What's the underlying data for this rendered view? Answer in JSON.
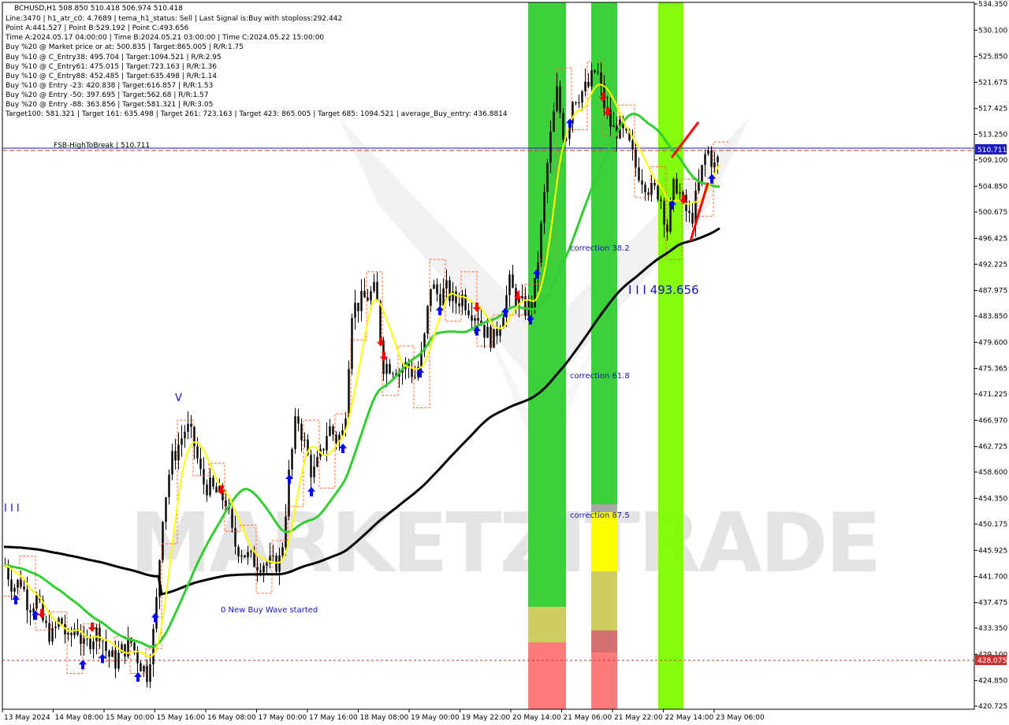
{
  "symbol_line": "BCHUSD,H1  508.850 510.418 506.974 510.418",
  "info_lines": [
    "Line:3470  |  h1_atr_c0: 4.7689  |  tema_h1_status: Sell  |  Last Signal is:Buy with stoploss:292.442",
    "Point A:441.527  |  Point B:529.192  |  Point C:493.656",
    "Time A:2024.05.17 04:00:00  |  Time B:2024.05.21 03:00:00  |  Time C:2024.05.22 15:00:00",
    "Buy %20 @ Market price or at: 500.835  |  Target:865.005  |  R/R:1.75",
    "Buy %10 @ C_Entry38: 495.704  |  Target:1094.521  |  R/R:2.95",
    "Buy %10 @ C_Entry61: 475.015  |  Target:723.163  |  R/R:1.36",
    "Buy %10 @ C_Entry88: 452.485  |  Target:635.498  |  R/R:1.14",
    "Buy %10 @ Entry -23: 420.838  |  Target:616.857  |  R/R:1.53",
    "Buy %20 @ Entry -50: 397.695  |  Target:562.68  |  R/R:1.57",
    "Buy %20 @ Entry -88: 363.856  |  Target:581.321  |  R/R:3.05",
    "Target100: 581.321  |  Target 161: 635.498  |  Target 261: 723.163  |  Target 423: 865.005  |  Target 685: 1094.521  |  average_Buy_entry: 436.8814"
  ],
  "annotations": {
    "fsb": "FSB-HighToBreak  |  510.711",
    "correction_38": "correction 38.2",
    "correction_61": "correction 61.8",
    "correction_87": "correction 87.5",
    "point_c": "I I I  493.656",
    "wave_start": "0 New Buy Wave started",
    "left_marker": "I I I",
    "v_marker": "V"
  },
  "price_axis": {
    "ticks": [
      "534.350",
      "530.100",
      "525.850",
      "521.675",
      "517.425",
      "513.250",
      "509.100",
      "504.850",
      "500.675",
      "496.425",
      "492.225",
      "487.975",
      "483.850",
      "479.600",
      "475.365",
      "471.225",
      "466.970",
      "462.725",
      "458.600",
      "454.350",
      "450.175",
      "445.925",
      "441.700",
      "437.475",
      "433.350",
      "429.100",
      "424.850",
      "420.725"
    ],
    "current_price": "510.711",
    "line_428": "428.075",
    "current_color": "#1e1ebe",
    "line_428_color": "#c83232"
  },
  "time_axis": {
    "labels": [
      "13 May 2024",
      "14 May 08:00",
      "15 May 00:00",
      "15 May 16:00",
      "16 May 08:00",
      "17 May 00:00",
      "17 May 16:00",
      "18 May 08:00",
      "19 May 00:00",
      "19 May 22:00",
      "20 May 14:00",
      "21 May 06:00",
      "21 May 22:00",
      "22 May 14:00",
      "23 May 06:00"
    ]
  },
  "watermark": "MARKETZITRADE",
  "colors": {
    "bull_band": "#32cd32",
    "bear_zone": "#ff6464",
    "yellow_zone": "#ffff00",
    "tema_fast": "#ffff00",
    "ma_mid": "#32cd32",
    "ma_slow": "#000000",
    "buy_arrow": "#0000ff",
    "sell_arrow": "#ff0000",
    "stop_line": "#ff6432"
  },
  "chart_data": {
    "type": "candlestick",
    "symbol": "BCHUSD",
    "timeframe": "H1",
    "ylim": [
      420.725,
      534.35
    ],
    "x_range": [
      "2024-05-13",
      "2024-05-23 09:00"
    ],
    "ohlc_last": {
      "open": 508.85,
      "high": 510.418,
      "low": 506.974,
      "close": 510.418
    },
    "key_levels": {
      "point_a": 441.527,
      "point_b": 529.192,
      "point_c": 493.656,
      "fsb_high_to_break": 510.711,
      "stop_line": 428.075
    },
    "price_path": [
      [
        0,
        443.5
      ],
      [
        10,
        440
      ],
      [
        20,
        441
      ],
      [
        30,
        437
      ],
      [
        40,
        438
      ],
      [
        50,
        433.5
      ],
      [
        60,
        432
      ],
      [
        70,
        435
      ],
      [
        80,
        431
      ],
      [
        90,
        434
      ],
      [
        100,
        430
      ],
      [
        110,
        432
      ],
      [
        120,
        433
      ],
      [
        130,
        429
      ],
      [
        140,
        428
      ],
      [
        150,
        430
      ],
      [
        160,
        431
      ],
      [
        170,
        428
      ],
      [
        180,
        426
      ],
      [
        190,
        434
      ],
      [
        200,
        452
      ],
      [
        210,
        460
      ],
      [
        220,
        463
      ],
      [
        230,
        466
      ],
      [
        240,
        463
      ],
      [
        250,
        457
      ],
      [
        260,
        456
      ],
      [
        270,
        455
      ],
      [
        280,
        454
      ],
      [
        290,
        447
      ],
      [
        300,
        446
      ],
      [
        310,
        444.5
      ],
      [
        320,
        444
      ],
      [
        330,
        444
      ],
      [
        340,
        443.5
      ],
      [
        350,
        444.5
      ],
      [
        360,
        458
      ],
      [
        370,
        468
      ],
      [
        380,
        463
      ],
      [
        390,
        458
      ],
      [
        400,
        461
      ],
      [
        410,
        466
      ],
      [
        420,
        464
      ],
      [
        430,
        465
      ],
      [
        440,
        485
      ],
      [
        450,
        486
      ],
      [
        460,
        487
      ],
      [
        470,
        488
      ],
      [
        480,
        476
      ],
      [
        490,
        476
      ],
      [
        500,
        475
      ],
      [
        510,
        476
      ],
      [
        520,
        474
      ],
      [
        530,
        478
      ],
      [
        540,
        489
      ],
      [
        550,
        487
      ],
      [
        560,
        488
      ],
      [
        570,
        486
      ],
      [
        580,
        487
      ],
      [
        590,
        485
      ],
      [
        600,
        484
      ],
      [
        610,
        481
      ],
      [
        620,
        480
      ],
      [
        630,
        484
      ],
      [
        640,
        489
      ],
      [
        650,
        486
      ],
      [
        660,
        485
      ],
      [
        670,
        486
      ],
      [
        680,
        498
      ],
      [
        690,
        511
      ],
      [
        700,
        520
      ],
      [
        710,
        512
      ],
      [
        720,
        519
      ],
      [
        730,
        520
      ],
      [
        740,
        521
      ],
      [
        750,
        524
      ],
      [
        760,
        518
      ],
      [
        770,
        514
      ],
      [
        780,
        514
      ],
      [
        790,
        512
      ],
      [
        800,
        508
      ],
      [
        810,
        506
      ],
      [
        820,
        504
      ],
      [
        830,
        504
      ],
      [
        840,
        498
      ],
      [
        850,
        506
      ],
      [
        860,
        502
      ],
      [
        870,
        499
      ],
      [
        880,
        505
      ],
      [
        890,
        511
      ],
      [
        900,
        508
      ],
      [
        910,
        510.4
      ]
    ]
  }
}
